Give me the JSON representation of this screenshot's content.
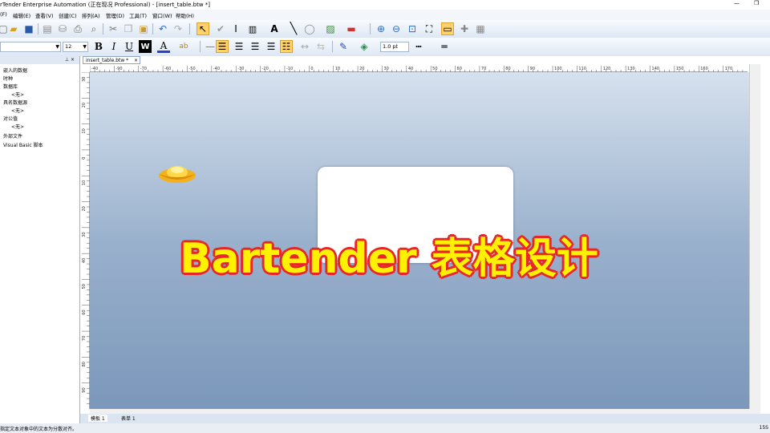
{
  "window": {
    "title": "rTender Enterprise Automation (正在现况 Professional) - [insert_table.btw *]",
    "minimize": "—",
    "restore": "❐"
  },
  "menu": [
    "(F)",
    "编辑(E)",
    "查看(V)",
    "创建(C)",
    "排列(A)",
    "管理(D)",
    "工具(T)",
    "窗口(W)",
    "帮助(H)"
  ],
  "format": {
    "font_size": "12",
    "line_width": "1.0 pt"
  },
  "left_panel": {
    "items": [
      "嵌入的数据",
      "时种",
      "数据库",
      "<无>",
      "具名数据源",
      "<无>",
      "对公值",
      "<无>",
      "外部文件",
      "Visual Basic 脚本"
    ]
  },
  "document": {
    "tab_label": "insert_table.btw *",
    "close": "×"
  },
  "ruler": {
    "top_labels": [
      "-40",
      "-90",
      "-70",
      "-60",
      "-50",
      "-40",
      "-30",
      "-20",
      "-10",
      "0",
      "10",
      "20",
      "30",
      "40",
      "50",
      "60",
      "70",
      "80",
      "90",
      "100",
      "110",
      "120",
      "130",
      "140",
      "150",
      "160",
      "170"
    ],
    "left_labels": [
      "30",
      "20",
      "10",
      "0",
      "10",
      "20",
      "30",
      "40",
      "50",
      "60",
      "70",
      "80",
      "90"
    ]
  },
  "bottom_tabs": {
    "template": "模板 1",
    "form": "表单 1"
  },
  "status": {
    "text": "指定文本对象中的文本为分散对齐。",
    "zoom": "15S"
  },
  "overlay": {
    "headline": "Bartender 表格设计"
  },
  "colors": {
    "headline_fill": "#fff200",
    "headline_stroke": "#e8262a",
    "canvas_top": "#d6e1ee",
    "canvas_bottom": "#7b97ba"
  }
}
